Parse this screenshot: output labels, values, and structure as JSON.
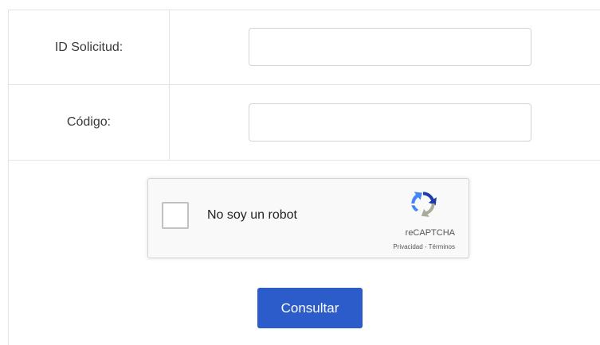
{
  "form": {
    "id_label": "ID Solicitud:",
    "id_value": "",
    "code_label": "Código:",
    "code_value": ""
  },
  "recaptcha": {
    "label": "No soy un robot",
    "brand": "reCAPTCHA",
    "privacy": "Privacidad",
    "separator": " - ",
    "terms": "Términos",
    "checked": false
  },
  "submit": {
    "label": "Consultar"
  },
  "colors": {
    "button": "#2b5cc9",
    "border": "#e3e3e3",
    "recaptcha_blue_dark": "#1c3aa9",
    "recaptcha_blue_light": "#4285f4",
    "recaptcha_gray": "#abab9a"
  },
  "icons": {
    "recaptcha_logo": "recaptcha-logo-icon"
  }
}
